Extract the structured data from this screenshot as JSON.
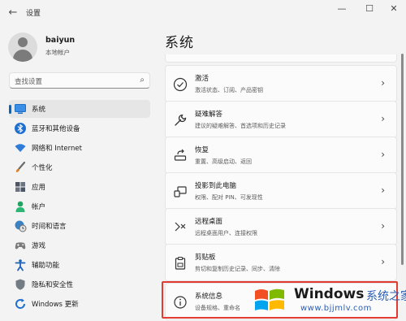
{
  "window": {
    "title": "设置"
  },
  "window_controls": [
    "—",
    "☐",
    "✕"
  ],
  "user": {
    "name": "baiyun",
    "account_type": "本地帐户"
  },
  "search": {
    "placeholder": "查找设置"
  },
  "sidebar": {
    "items": [
      {
        "label": "系统",
        "icon": "monitor-icon",
        "active": true
      },
      {
        "label": "蓝牙和其他设备",
        "icon": "bluetooth-icon"
      },
      {
        "label": "网络和 Internet",
        "icon": "wifi-icon"
      },
      {
        "label": "个性化",
        "icon": "brush-icon"
      },
      {
        "label": "应用",
        "icon": "apps-icon"
      },
      {
        "label": "帐户",
        "icon": "person-icon"
      },
      {
        "label": "时间和语言",
        "icon": "globe-clock-icon"
      },
      {
        "label": "游戏",
        "icon": "gamepad-icon"
      },
      {
        "label": "辅助功能",
        "icon": "accessibility-icon"
      },
      {
        "label": "隐私和安全性",
        "icon": "shield-icon"
      },
      {
        "label": "Windows 更新",
        "icon": "update-icon"
      }
    ]
  },
  "main": {
    "title": "系统",
    "cards": [
      {
        "title": "激活",
        "subtitle": "激活状态、订阅、产品密钥",
        "icon": "activation-check-icon"
      },
      {
        "title": "疑难解答",
        "subtitle": "建议的疑难解答、首选项和历史记录",
        "icon": "wrench-icon"
      },
      {
        "title": "恢复",
        "subtitle": "重置、高级启动、返回",
        "icon": "recovery-icon"
      },
      {
        "title": "投影到此电脑",
        "subtitle": "权限、配对 PIN、可发现性",
        "icon": "projection-icon"
      },
      {
        "title": "远程桌面",
        "subtitle": "远程桌面用户、连接权限",
        "icon": "remote-desktop-icon"
      },
      {
        "title": "剪贴板",
        "subtitle": "剪切和复制历史记录、同步、清除",
        "icon": "clipboard-icon"
      },
      {
        "title": "系统信息",
        "subtitle": "设备规格、重命名",
        "icon": "info-icon"
      }
    ]
  },
  "watermark": {
    "brand": "Windows",
    "brand_suffix": "系统之家",
    "url": "www.bjjmlv.com"
  },
  "colors": {
    "accent": "#0067c0",
    "highlight": "#e23b31",
    "watermark_blue": "#2a5db5"
  }
}
